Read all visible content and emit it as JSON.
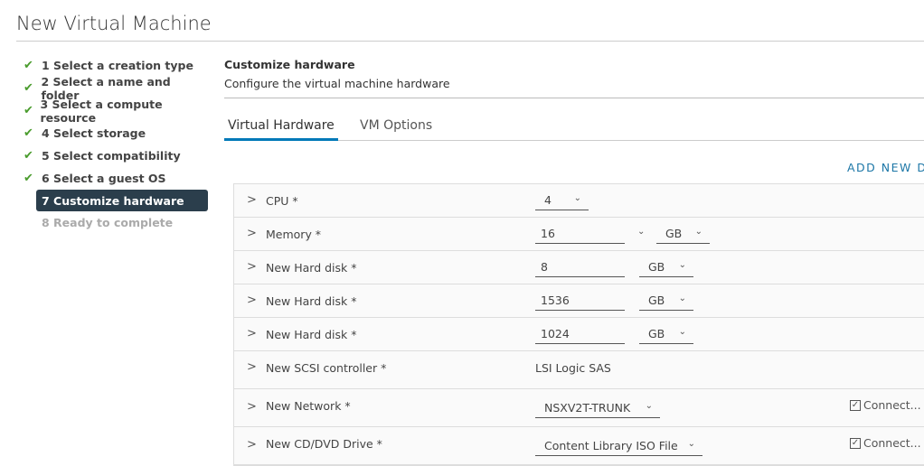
{
  "title": "New Virtual Machine",
  "steps": [
    {
      "label": "1 Select a creation type",
      "status": "done"
    },
    {
      "label": "2 Select a name and folder",
      "status": "done"
    },
    {
      "label": "3 Select a compute resource",
      "status": "done"
    },
    {
      "label": "4 Select storage",
      "status": "done"
    },
    {
      "label": "5 Select compatibility",
      "status": "done"
    },
    {
      "label": "6 Select a guest OS",
      "status": "done"
    },
    {
      "label": "7 Customize hardware",
      "status": "active"
    },
    {
      "label": "8 Ready to complete",
      "status": "todo"
    }
  ],
  "header": {
    "title": "Customize hardware",
    "subtitle": "Configure the virtual machine hardware"
  },
  "tabs": [
    {
      "label": "Virtual Hardware",
      "selected": true
    },
    {
      "label": "VM Options",
      "selected": false
    }
  ],
  "add_device": "ADD NEW D",
  "rows": {
    "cpu": {
      "label": "CPU *",
      "value": "4"
    },
    "memory": {
      "label": "Memory *",
      "value": "16",
      "unit": "GB"
    },
    "hd1": {
      "label": "New Hard disk *",
      "value": "8",
      "unit": "GB"
    },
    "hd2": {
      "label": "New Hard disk *",
      "value": "1536",
      "unit": "GB"
    },
    "hd3": {
      "label": "New Hard disk *",
      "value": "1024",
      "unit": "GB"
    },
    "scsi": {
      "label": "New SCSI controller *",
      "value": "LSI Logic SAS"
    },
    "network": {
      "label": "New Network *",
      "value": "NSXV2T-TRUNK",
      "connect": "Connect...",
      "connected": true
    },
    "cdrom": {
      "label": "New CD/DVD Drive *",
      "value": "Content Library ISO File",
      "connect": "Connect...",
      "connected": true
    }
  },
  "colors": {
    "accent": "#0079b8",
    "active_step": "#2b3e4c",
    "check": "#4a9c2d"
  }
}
